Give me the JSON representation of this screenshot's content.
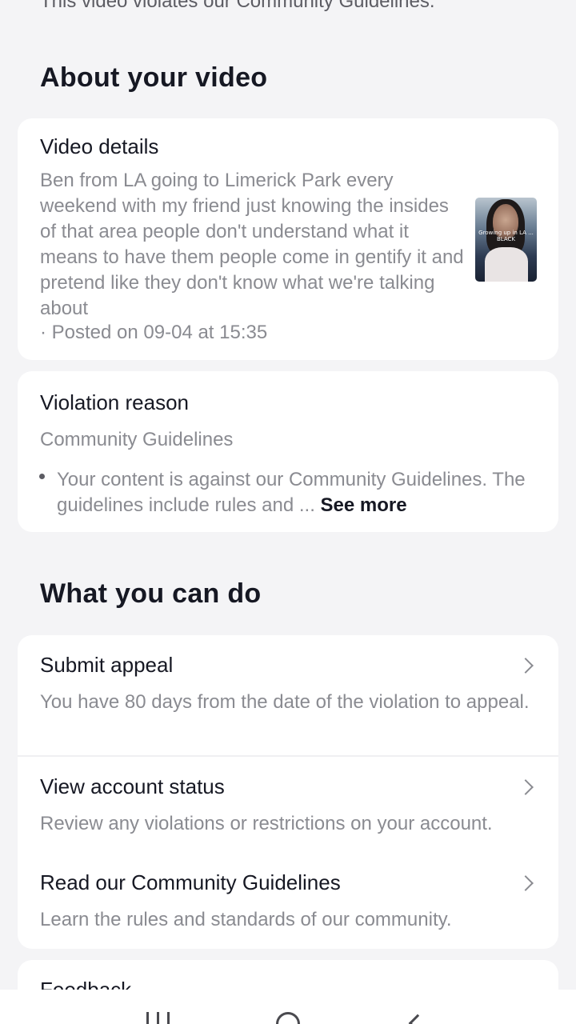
{
  "top_notice": "This video violates our Community Guidelines.",
  "about": {
    "title": "About your video",
    "video_details": {
      "heading": "Video details",
      "description": "Ben from LA going to Limerick Park every weekend with my friend just knowing the insides of that area people don't understand what it means to have them people come in gentify it and pretend like they don't know what we're talking about",
      "posted": "· Posted on 09-04 at 15:35",
      "thumbnail_caption": "Growing up in LA ... BLACK"
    },
    "violation": {
      "heading": "Violation reason",
      "category": "Community Guidelines",
      "text": "Your content is against our Community Guidelines. The guidelines include rules and ...",
      "see_more": "See more"
    }
  },
  "actions": {
    "title": "What you can do",
    "items": [
      {
        "label": "Submit appeal",
        "description": "You have 80 days from the date of the violation to appeal.",
        "icon": "chevron-right-icon"
      },
      {
        "label": "View account status",
        "description": "Review any violations or restrictions on your account.",
        "icon": "chevron-right-icon"
      },
      {
        "label": "Read our Community Guidelines",
        "description": "Learn the rules and standards of our community.",
        "icon": "chevron-right-icon"
      }
    ]
  },
  "feedback": {
    "heading": "Feedback"
  },
  "system_nav": {
    "recent_icon": "recent-apps-icon",
    "home_icon": "home-icon",
    "back_icon": "back-icon"
  }
}
